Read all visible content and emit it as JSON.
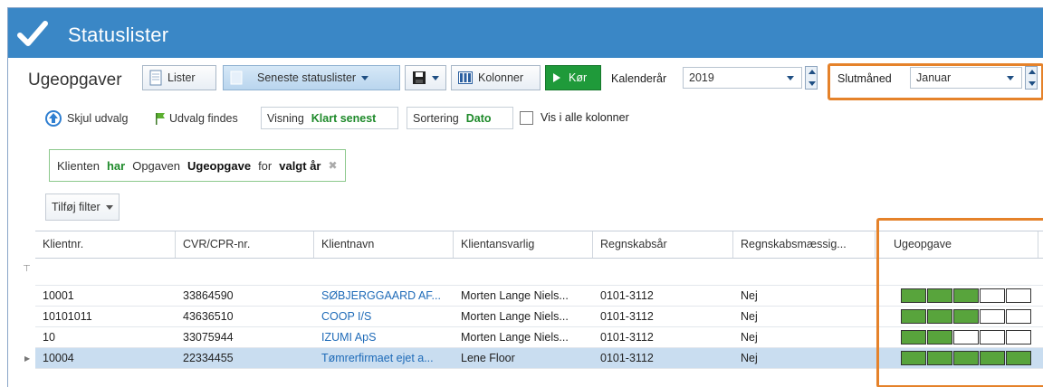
{
  "app": {
    "title": "Statuslister"
  },
  "toolbar": {
    "section_title": "Ugeopgaver",
    "lister_label": "Lister",
    "recent_label": "Seneste statuslister",
    "columns_label": "Kolonner",
    "run_label": "Kør",
    "year_label": "Kalenderår",
    "year_value": "2019",
    "endmonth_label": "Slutmåned",
    "endmonth_value": "Januar"
  },
  "filters": {
    "hide_label": "Skjul udvalg",
    "exists_label": "Udvalg findes",
    "view_label": "Visning",
    "view_value": "Klart senest",
    "sort_label": "Sortering",
    "sort_value": "Dato",
    "show_all_label": "Vis i alle kolonner",
    "add_filter_label": "Tilføj filter"
  },
  "criteria": {
    "w1": "Klienten",
    "w2": "har",
    "w3": "Opgaven",
    "w4": "Ugeopgave",
    "w5": "for",
    "w6": "valgt år"
  },
  "grid": {
    "headers": [
      "Klientnr.",
      "CVR/CPR-nr.",
      "Klientnavn",
      "Klientansvarlig",
      "Regnskabsår",
      "Regnskabsmæssig...",
      "Ugeopgave"
    ],
    "rows": [
      {
        "nr": "10001",
        "cvr": "33864590",
        "name": "SØBJERGGAARD AF...",
        "resp": "Morten Lange Niels...",
        "year": "0101-3112",
        "flag": "Nej",
        "progress": [
          1,
          1,
          1,
          0,
          0
        ]
      },
      {
        "nr": "10101011",
        "cvr": "43636510",
        "name": "COOP I/S",
        "resp": "Morten Lange Niels...",
        "year": "0101-3112",
        "flag": "Nej",
        "progress": [
          1,
          1,
          1,
          0,
          0
        ]
      },
      {
        "nr": "10",
        "cvr": "33075944",
        "name": "IZUMI ApS",
        "resp": "Morten Lange Niels...",
        "year": "0101-3112",
        "flag": "Nej",
        "progress": [
          1,
          1,
          0,
          0,
          0
        ]
      },
      {
        "nr": "10004",
        "cvr": "22334455",
        "name": "Tømrerfirmaet ejet a...",
        "resp": "Lene Floor",
        "year": "0101-3112",
        "flag": "Nej",
        "progress": [
          1,
          1,
          1,
          1,
          1
        ]
      }
    ]
  },
  "colors": {
    "accent": "#3a87c6",
    "highlight": "#e5822a",
    "task_done": "#58a43c"
  }
}
